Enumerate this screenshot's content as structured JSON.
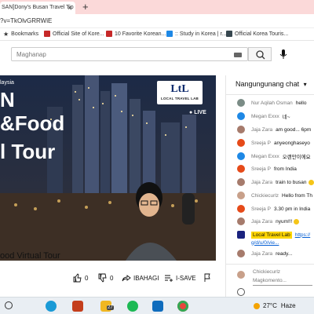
{
  "browser": {
    "tab_title": "SAN]Dony's Busan Travel Tip",
    "new_tab_symbol": "+",
    "close_symbol": "×",
    "url": "?v=TkOlvGRRWiE"
  },
  "bookmarks": [
    {
      "label": "Bookmarks",
      "icon": "star-icon",
      "color": "#222222"
    },
    {
      "label": "Official Site of Kore...",
      "icon": "site-icon",
      "color": "#c62828"
    },
    {
      "label": "10 Favorite Korean...",
      "icon": "site-icon",
      "color": "#c62828"
    },
    {
      "label": ":: Study in Korea | r...",
      "icon": "site-icon",
      "color": "#1e88e5"
    },
    {
      "label": "Official Korea Touris...",
      "icon": "site-icon",
      "color": "#37474f"
    }
  ],
  "youtube": {
    "search_placeholder": "Maghanap",
    "video": {
      "partial_line_top": "laysia",
      "big_line_1": "N",
      "big_line_2": "&Food",
      "big_line_3": "l Tour",
      "brand_text": "LOCAL TRAVEL LAB",
      "brand_logo_text": "LtL",
      "live_label": "LIVE"
    },
    "title": "ood Virtual Tour",
    "actions": {
      "like_count": "0",
      "dislike_count": "0",
      "share_label": "IBAHAGI",
      "save_label": "I-SAVE"
    }
  },
  "chat": {
    "header": "Nangungunang chat",
    "messages": [
      {
        "author": "Nur Aqilah Osman",
        "text": "hello",
        "avatar_color": "#7b8c86"
      },
      {
        "author": "Megan Exxx",
        "text": "네~",
        "avatar_color": "#1e88e5"
      },
      {
        "author": "Jaja Zara",
        "text": "am good... 6pm",
        "avatar_color": "#a67b6c"
      },
      {
        "author": "Sreeja P",
        "text": "anyeonghaseyo",
        "avatar_color": "#e64a19"
      },
      {
        "author": "Megan Exxx",
        "text": "오랜만이에요",
        "avatar_color": "#1e88e5"
      },
      {
        "author": "Sreeja P",
        "text": "from India",
        "avatar_color": "#e64a19"
      },
      {
        "author": "Jaja Zara",
        "text": "train to busan",
        "avatar_color": "#a67b6c"
      },
      {
        "author": "Chickiecurlz",
        "text": "Hello from Th",
        "avatar_color": "#c8a08a"
      },
      {
        "author": "Sreeja P",
        "text": "3.30 pm in India",
        "avatar_color": "#e64a19"
      },
      {
        "author": "Jaja Zara",
        "text": "nyum!!!",
        "avatar_color": "#a67b6c"
      },
      {
        "author": "Local Travel Lab",
        "text": "https://",
        "owner": true,
        "avatar_color": "#1a237e"
      },
      {
        "author": "",
        "text": "g/d/u/0/vie...",
        "link": true,
        "avatar_color": ""
      },
      {
        "author": "Jaja Zara",
        "text": "ready...",
        "avatar_color": "#a67b6c"
      }
    ],
    "input_author": "Chickiecurlz",
    "input_placeholder": "Magkomento..."
  },
  "taskbar": {
    "temperature": "27°C",
    "weather_text": "Haze",
    "badge_count": "27"
  }
}
